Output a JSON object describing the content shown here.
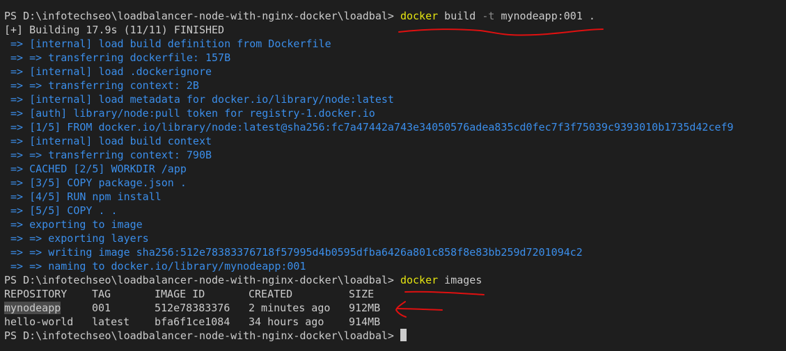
{
  "colors": {
    "background": "#1e1e1e",
    "text": "#cccccc",
    "step_text": "#3b8eea",
    "command": "#e5e510",
    "flag": "#8a8a8a",
    "annotation": "#e01010"
  },
  "prompt": "PS D:\\infotechseo\\loadbalancer-node-with-nginx-docker\\loadbal>",
  "cmd1": {
    "name": "docker",
    "sub": "build",
    "flag": "-t",
    "args": "mynodeapp:001 ."
  },
  "build_status": "[+] Building 17.9s (11/11) FINISHED",
  "build_steps": [
    " => [internal] load build definition from Dockerfile",
    " => => transferring dockerfile: 157B",
    " => [internal] load .dockerignore",
    " => => transferring context: 2B",
    " => [internal] load metadata for docker.io/library/node:latest",
    " => [auth] library/node:pull token for registry-1.docker.io",
    " => [1/5] FROM docker.io/library/node:latest@sha256:fc7a47442a743e34050576adea835cd0fec7f3f75039c9393010b1735d42cef9",
    " => [internal] load build context",
    " => => transferring context: 790B",
    " => CACHED [2/5] WORKDIR /app",
    " => [3/5] COPY package.json .",
    " => [4/5] RUN npm install",
    " => [5/5] COPY . .",
    " => exporting to image",
    " => => exporting layers",
    " => => writing image sha256:512e78383376718f57995d4b0595dfba6426a801c858f8e83bb259d7201094c2",
    " => => naming to docker.io/library/mynodeapp:001"
  ],
  "cmd2": {
    "name": "docker",
    "sub": "images"
  },
  "images_table": {
    "headers": [
      "REPOSITORY",
      "TAG",
      "IMAGE ID",
      "CREATED",
      "SIZE"
    ],
    "rows": [
      [
        "mynodeapp",
        "001",
        "512e78383376",
        "2 minutes ago",
        "912MB"
      ],
      [
        "hello-world",
        "latest",
        "bfa6f1ce1084",
        "34 hours ago",
        "914MB"
      ]
    ]
  }
}
